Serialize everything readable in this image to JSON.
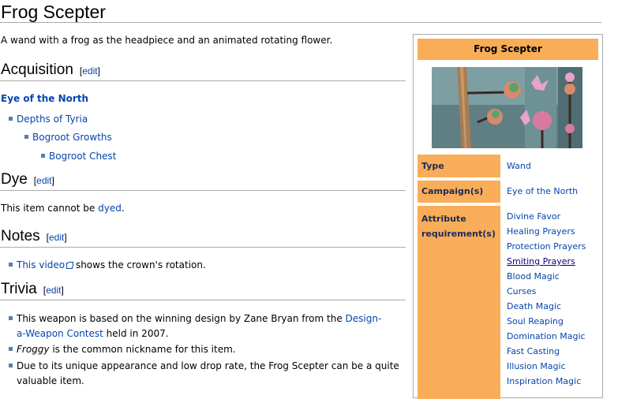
{
  "page": {
    "title": "Frog Scepter",
    "lead": "A wand with a frog as the headpiece and an animated rotating flower."
  },
  "acquisition": {
    "heading": "Acquisition",
    "edit": "edit",
    "region": "Eye of the North",
    "items": [
      "Depths of Tyria",
      "Bogroot Growths",
      "Bogroot Chest"
    ]
  },
  "dye": {
    "heading": "Dye",
    "edit": "edit",
    "text_before": "This item cannot be ",
    "link": "dyed",
    "text_after": "."
  },
  "notes": {
    "heading": "Notes",
    "edit": "edit",
    "link": "This video",
    "text_after": " shows the crown's rotation."
  },
  "trivia": {
    "heading": "Trivia",
    "edit": "edit",
    "item1_before": "This weapon is based on the winning design by Zane Bryan from the ",
    "item1_link_a": "Design-",
    "item1_link_b": "a-Weapon Contest",
    "item1_after": " held in 2007.",
    "item2_em": "Froggy",
    "item2_after": " is the common nickname for this item.",
    "item3_a": "Due to its unique appearance and low drop rate, the Frog Scepter can be a quite",
    "item3_b": "valuable item."
  },
  "infobox": {
    "title": "Frog Scepter",
    "type_label": "Type",
    "type_value": "Wand",
    "campaign_label": "Campaign(s)",
    "campaign_value": "Eye of the North",
    "attr_label_1": "Attribute",
    "attr_label_2": "requirement(s)",
    "attributes": [
      "Divine Favor",
      "Healing Prayers",
      "Protection Prayers",
      "Smiting Prayers",
      "Blood Magic",
      "Curses",
      "Death Magic",
      "Soul Reaping",
      "Domination Magic",
      "Fast Casting",
      "Illusion Magic",
      "Inspiration Magic"
    ]
  }
}
